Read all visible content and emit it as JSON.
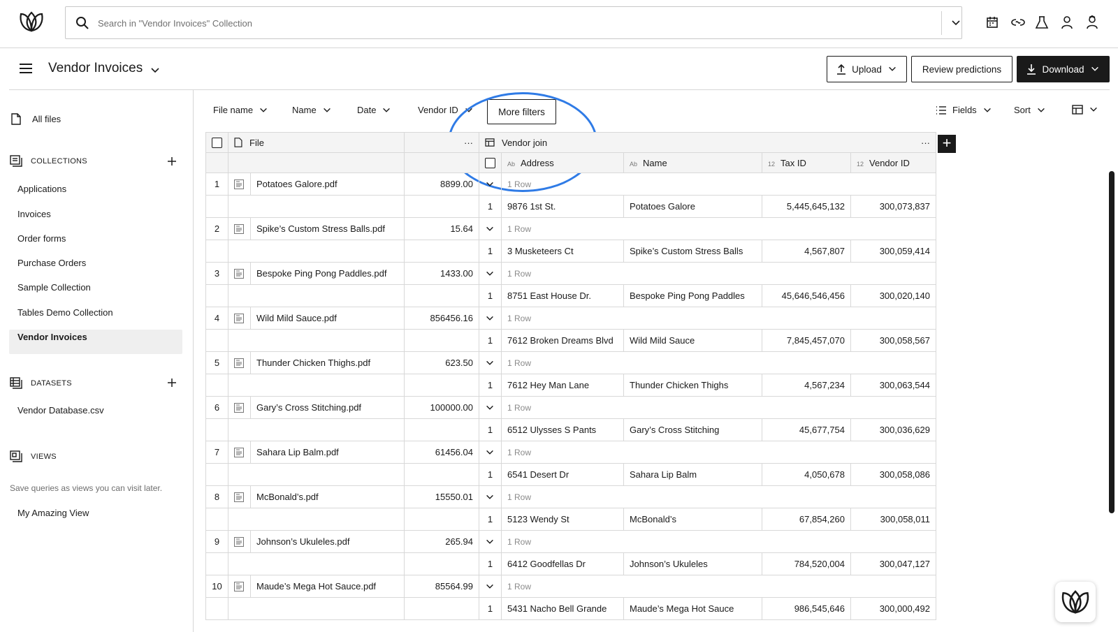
{
  "search": {
    "placeholder": "Search in \"Vendor Invoices\" Collection"
  },
  "header": {
    "title": "Vendor Invoices",
    "upload_label": "Upload",
    "review_label": "Review predictions",
    "download_label": "Download"
  },
  "sidebar": {
    "all_files": "All files",
    "collections_heading": "COLLECTIONS",
    "collections": [
      "Applications",
      "Invoices",
      "Order forms",
      "Purchase Orders",
      "Sample Collection",
      "Tables Demo Collection",
      "Vendor Invoices"
    ],
    "active_collection": "Vendor Invoices",
    "datasets_heading": "DATASETS",
    "datasets": [
      "Vendor Database.csv"
    ],
    "views_heading": "VIEWS",
    "views_hint": "Save queries as views you can visit later.",
    "views": [
      "My Amazing View"
    ]
  },
  "filters": {
    "items": [
      "File name",
      "Name",
      "Date",
      "Vendor ID"
    ],
    "more_filters": "More filters",
    "fields": "Fields",
    "sort": "Sort"
  },
  "table": {
    "file_header": "File",
    "join_header": "Vendor join",
    "columns": {
      "address": "Address",
      "name": "Name",
      "tax_id": "Tax ID",
      "vendor_id": "Vendor ID"
    },
    "type_labels": {
      "text": "Ab",
      "number": "12"
    },
    "row_summary": "1 Row",
    "sub_index": "1",
    "rows": [
      {
        "n": "1",
        "file": "Potatoes Galore.pdf",
        "value": "8899.00",
        "address": "9876 1st St.",
        "name": "Potatoes Galore",
        "tax_id": "5,445,645,132",
        "vendor_id": "300,073,837"
      },
      {
        "n": "2",
        "file": "Spike’s Custom Stress Balls.pdf",
        "value": "15.64",
        "address": "3 Musketeers Ct",
        "name": "Spike’s Custom Stress Balls",
        "tax_id": "4,567,807",
        "vendor_id": "300,059,414"
      },
      {
        "n": "3",
        "file": "Bespoke Ping Pong Paddles.pdf",
        "value": "1433.00",
        "address": "8751 East House Dr.",
        "name": "Bespoke Ping Pong Paddles",
        "tax_id": "45,646,546,456",
        "vendor_id": "300,020,140"
      },
      {
        "n": "4",
        "file": "Wild Mild Sauce.pdf",
        "value": "856456.16",
        "address": "7612 Broken Dreams Blvd",
        "name": "Wild Mild Sauce",
        "tax_id": "7,845,457,070",
        "vendor_id": "300,058,567"
      },
      {
        "n": "5",
        "file": "Thunder Chicken Thighs.pdf",
        "value": "623.50",
        "address": "7612 Hey Man Lane",
        "name": "Thunder Chicken Thighs",
        "tax_id": "4,567,234",
        "vendor_id": "300,063,544"
      },
      {
        "n": "6",
        "file": "Gary’s Cross Stitching.pdf",
        "value": "100000.00",
        "address": "6512 Ulysses S Pants",
        "name": "Gary’s Cross Stitching",
        "tax_id": "45,677,754",
        "vendor_id": "300,036,629"
      },
      {
        "n": "7",
        "file": "Sahara Lip Balm.pdf",
        "value": "61456.04",
        "address": "6541 Desert Dr",
        "name": "Sahara Lip Balm",
        "tax_id": "4,050,678",
        "vendor_id": "300,058,086"
      },
      {
        "n": "8",
        "file": "McBonald’s.pdf",
        "value": "15550.01",
        "address": "5123 Wendy St",
        "name": "McBonald’s",
        "tax_id": "67,854,260",
        "vendor_id": "300,058,011"
      },
      {
        "n": "9",
        "file": "Johnson’s Ukuleles.pdf",
        "value": "265.94",
        "address": "6412 Goodfellas Dr",
        "name": "Johnson’s Ukuleles",
        "tax_id": "784,520,004",
        "vendor_id": "300,047,127"
      },
      {
        "n": "10",
        "file": "Maude’s Mega Hot Sauce.pdf",
        "value": "85564.99",
        "address": "5431 Nacho Bell Grande",
        "name": "Maude’s Mega Hot Sauce",
        "tax_id": "986,545,646",
        "vendor_id": "300,000,492"
      }
    ]
  },
  "colors": {
    "highlight": "#2f7be6",
    "primary": "#1a1a1a"
  }
}
